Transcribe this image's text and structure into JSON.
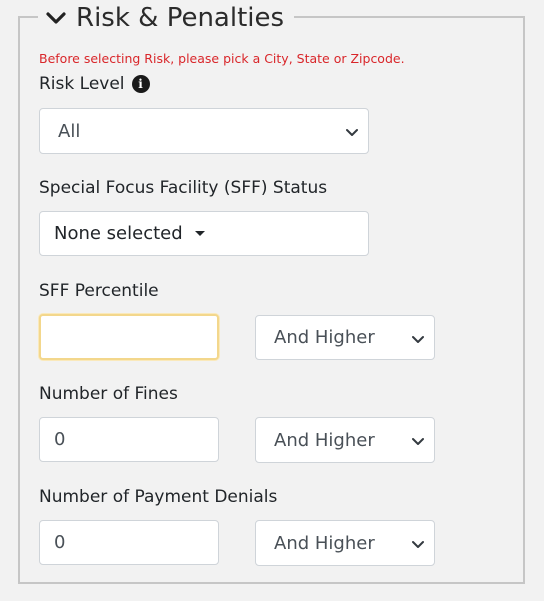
{
  "section": {
    "title": "Risk & Penalties",
    "warning": "Before selecting Risk, please pick a City, State or Zipcode."
  },
  "risk_level": {
    "label": "Risk Level",
    "selected": "All",
    "info_icon": "info-circle-icon"
  },
  "sff_status": {
    "label": "Special Focus Facility (SFF) Status",
    "selected": "None selected"
  },
  "sff_percentile": {
    "label": "SFF Percentile",
    "value": "",
    "comparator": "And Higher"
  },
  "fines": {
    "label": "Number of Fines",
    "value": "0",
    "comparator": "And Higher"
  },
  "payment_denials": {
    "label": "Number of Payment Denials",
    "value": "0",
    "comparator": "And Higher"
  },
  "colors": {
    "warning": "#d9262a",
    "focus_border": "#f3d78c",
    "background": "#f2f2f2"
  }
}
